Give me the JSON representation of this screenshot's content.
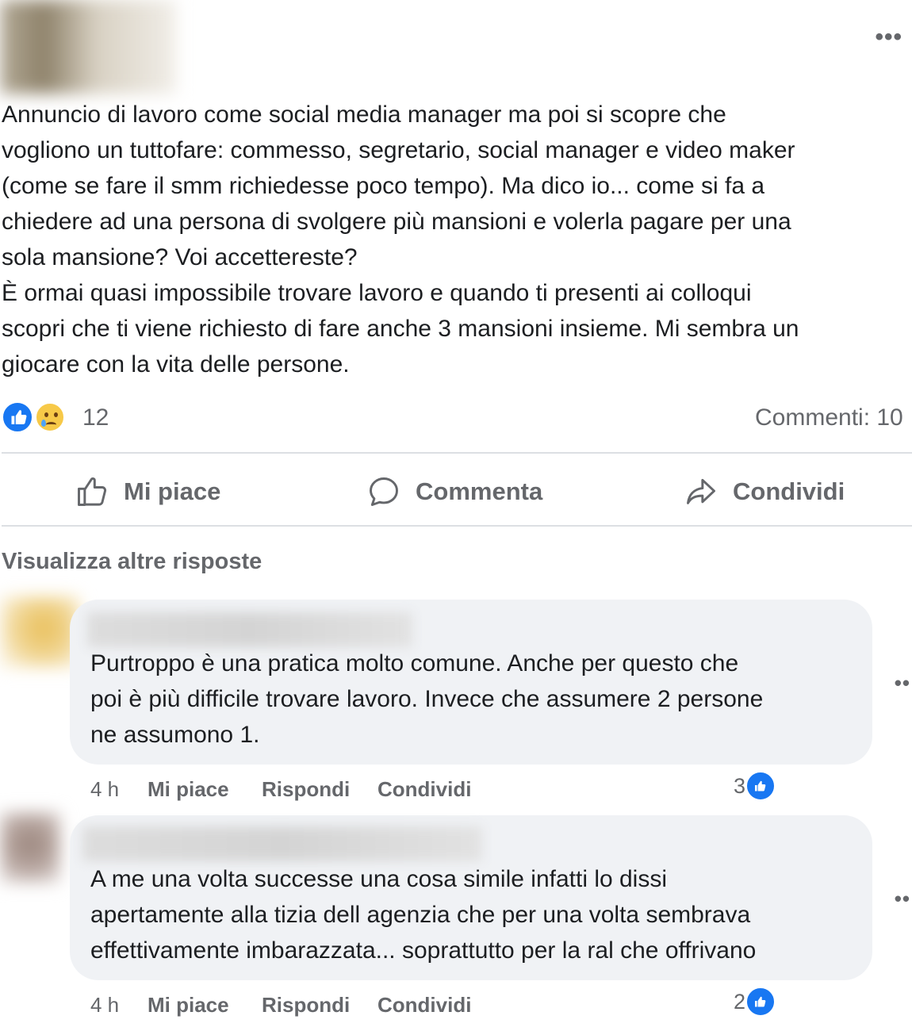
{
  "post": {
    "text_lines": [
      "Annuncio di lavoro come social media manager ma poi si scopre che",
      "vogliono un tuttofare: commesso, segretario, social manager e video maker",
      "(come se fare il smm richiedesse poco tempo). Ma dico io... come si fa a",
      "chiedere ad una persona di svolgere più mansioni e volerla pagare per una",
      "sola mansione? Voi accettereste?",
      "È ormai quasi impossibile trovare lavoro e quando ti presenti ai colloqui",
      "scopri che ti viene richiesto di fare anche 3 mansioni insieme. Mi sembra un",
      "giocare con la vita delle persone."
    ],
    "more_icon": "•••",
    "reaction_count": "12",
    "comments_label": "Commenti: 10"
  },
  "actions": {
    "like": "Mi piace",
    "comment": "Commenta",
    "share": "Condividi"
  },
  "more_replies": "Visualizza altre risposte",
  "comments": [
    {
      "text_lines": [
        "Purtroppo è una pratica molto comune. Anche per questo che",
        "poi è più difficile trovare lavoro. Invece che assumere 2 persone",
        "ne assumono 1."
      ],
      "time": "4 h",
      "like": "Mi piace",
      "reply": "Rispondi",
      "share": "Condividi",
      "reactions": "3",
      "more_icon": "••"
    },
    {
      "text_lines": [
        "A me una volta successe una cosa simile infatti lo dissi",
        "apertamente alla tizia dell agenzia che per una volta sembrava",
        "effettivamente imbarazzata... soprattutto per la ral che offrivano"
      ],
      "time": "4 h",
      "like": "Mi piace",
      "reply": "Rispondi",
      "share": "Condividi",
      "reactions": "2",
      "more_icon": "••"
    }
  ],
  "colors": {
    "accent": "#1877f2",
    "muted_text": "#65676b",
    "bubble": "#f0f2f5"
  }
}
